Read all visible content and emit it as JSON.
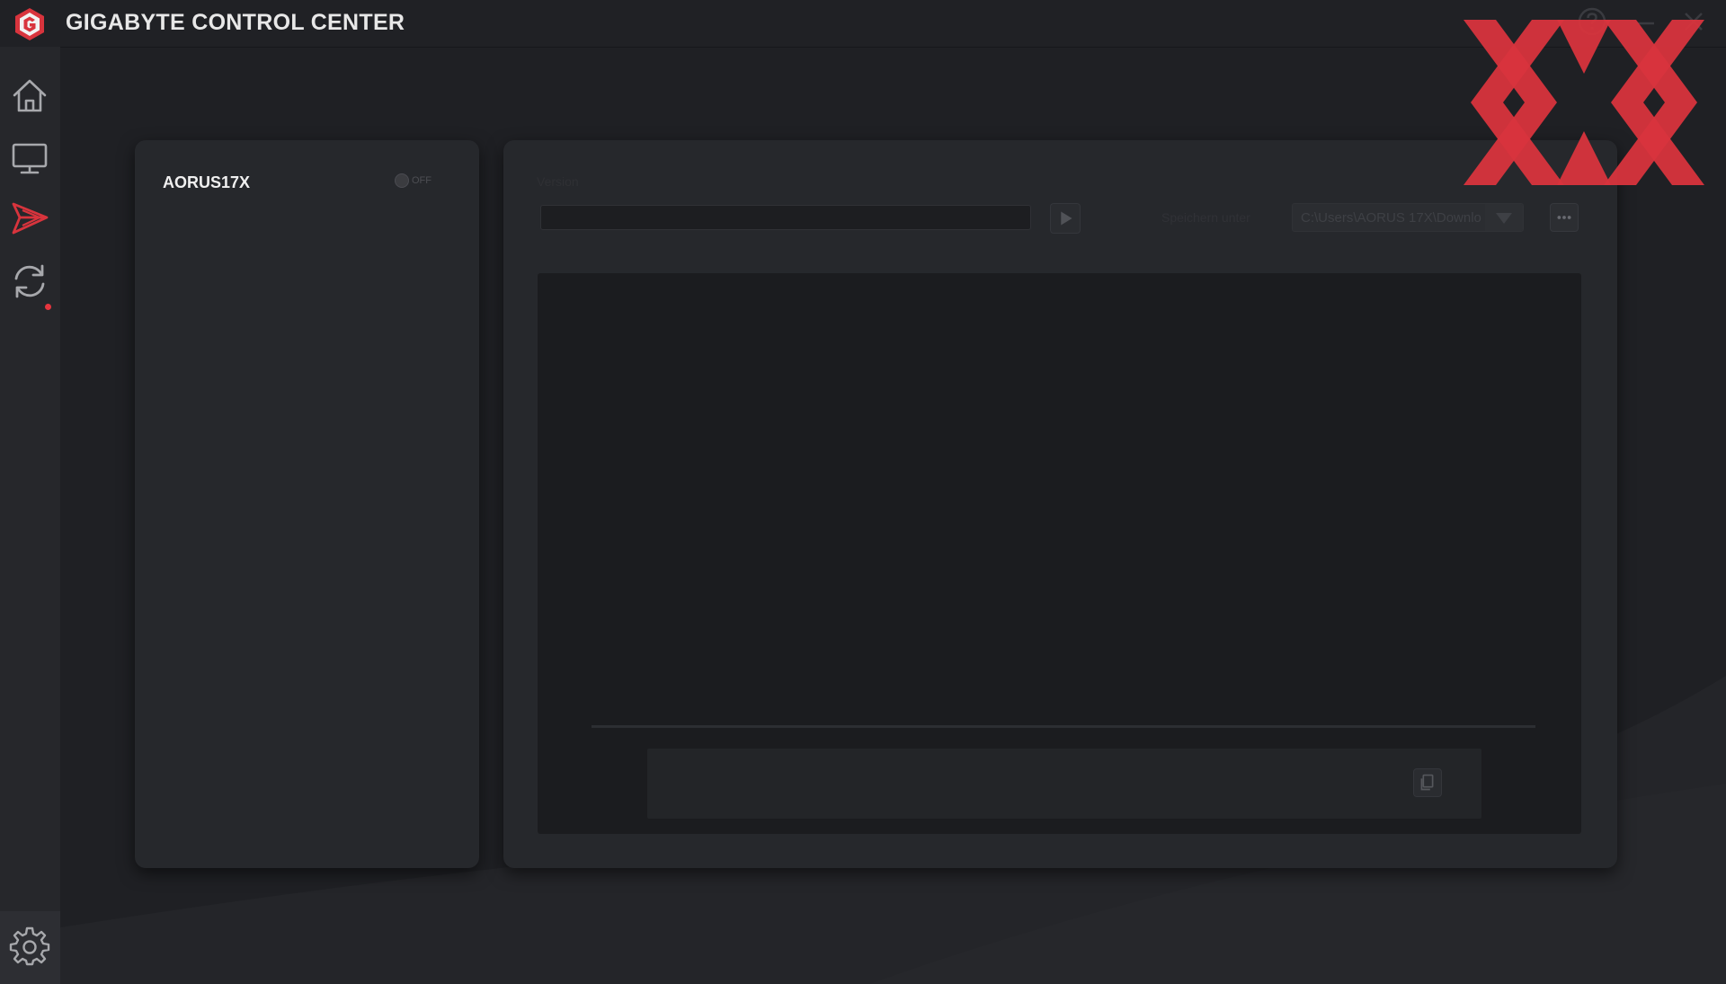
{
  "window": {
    "title": "GIGABYTE CONTROL CENTER",
    "icons": {
      "help": "help-icon",
      "minimize": "minimize-icon",
      "close": "close-icon"
    }
  },
  "nav": {
    "items": [
      {
        "id": "home",
        "icon": "home-icon"
      },
      {
        "id": "display",
        "icon": "monitor-icon"
      },
      {
        "id": "fly",
        "icon": "paper-plane-icon",
        "active": true
      },
      {
        "id": "update",
        "icon": "refresh-icon",
        "badge": true
      }
    ],
    "settings_icon": "gear-icon"
  },
  "device": {
    "name": "AORUS17X",
    "toggle_label": "OFF",
    "toggle_on": false
  },
  "main": {
    "version_label": "Version",
    "url_value": "",
    "save_label": "Speichern unter",
    "save_path": "C:\\Users\\AORUS 17X\\Downlo",
    "output_text": ""
  },
  "colors": {
    "accent": "#d8343d",
    "background": "#1f2024",
    "panel": "#26282c",
    "watermark": "#d8343d"
  }
}
